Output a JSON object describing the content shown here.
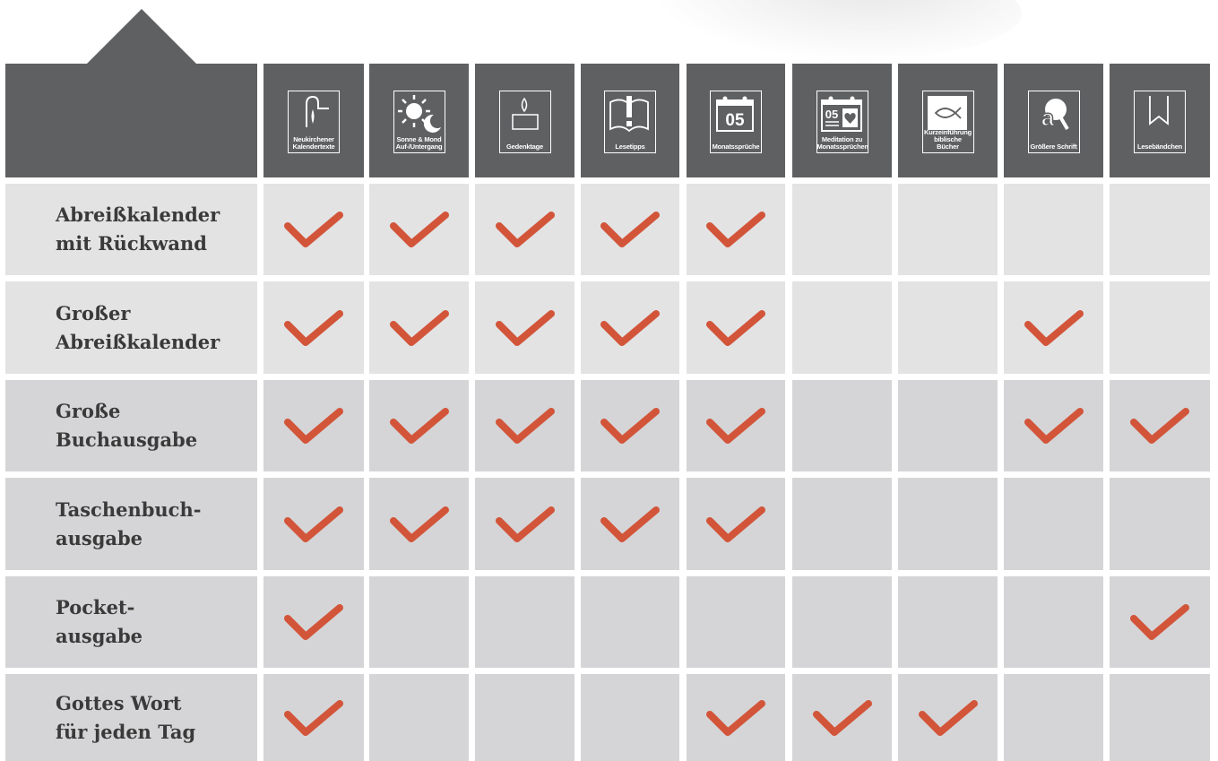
{
  "columns": [
    {
      "icon": "pen-icon",
      "line1": "Neukirchener",
      "line2": "Kalendertexte"
    },
    {
      "icon": "sun-moon-icon",
      "line1": "Sonne & Mond",
      "line2": "Auf-/Untergang"
    },
    {
      "icon": "candle-icon",
      "line1": "Gedenktage",
      "line2": ""
    },
    {
      "icon": "book-exclamation-icon",
      "line1": "Lesetipps",
      "line2": ""
    },
    {
      "icon": "calendar-05-icon",
      "line1": "Monatssprüche",
      "line2": ""
    },
    {
      "icon": "calendar-heart-icon",
      "line1": "Meditation zu",
      "line2": "Monatssprüchen"
    },
    {
      "icon": "fish-icon",
      "line1": "Kurzeinführung",
      "line2": "biblische Bücher"
    },
    {
      "icon": "magnifier-a-icon",
      "line1": "Größere Schrift",
      "line2": ""
    },
    {
      "icon": "bookmark-icon",
      "line1": "Lesebändchen",
      "line2": ""
    }
  ],
  "rows": [
    {
      "line1": "Abreißkalender",
      "line2": "mit Rückwand",
      "checks": [
        1,
        1,
        1,
        1,
        1,
        0,
        0,
        0,
        0
      ]
    },
    {
      "line1": "Großer",
      "line2": "Abreißkalender",
      "checks": [
        1,
        1,
        1,
        1,
        1,
        0,
        0,
        1,
        0
      ]
    },
    {
      "line1": "Große",
      "line2": "Buchausgabe",
      "checks": [
        1,
        1,
        1,
        1,
        1,
        0,
        0,
        1,
        1
      ]
    },
    {
      "line1": "Taschenbuch-",
      "line2": "ausgabe",
      "checks": [
        1,
        1,
        1,
        1,
        1,
        0,
        0,
        0,
        0
      ]
    },
    {
      "line1": "Pocket-",
      "line2": "ausgabe",
      "checks": [
        1,
        0,
        0,
        0,
        0,
        0,
        0,
        0,
        1
      ]
    },
    {
      "line1": "Gottes Wort",
      "line2": "für jeden Tag",
      "checks": [
        1,
        0,
        0,
        0,
        1,
        1,
        1,
        0,
        0
      ]
    }
  ],
  "colors": {
    "header": "#5f6062",
    "check": "#d2553a",
    "row_light": "#e3e3e4",
    "row_dark": "#d5d5d7"
  }
}
